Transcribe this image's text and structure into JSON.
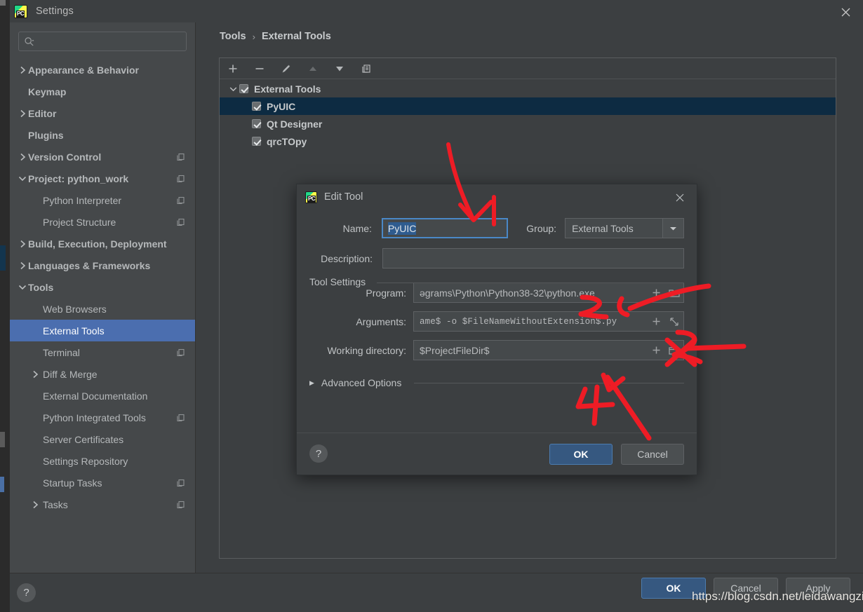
{
  "window": {
    "title": "Settings",
    "logo_icon": "pycharm-logo-icon",
    "close_icon": "close-icon"
  },
  "search": {
    "placeholder": "",
    "value": "",
    "icon": "search-icon"
  },
  "sidebar": {
    "items": [
      {
        "label": "Appearance & Behavior",
        "level": 1,
        "arrow": "chevron-right",
        "badge": false,
        "selected": false
      },
      {
        "label": "Keymap",
        "level": 1,
        "arrow": "",
        "badge": false,
        "selected": false
      },
      {
        "label": "Editor",
        "level": 1,
        "arrow": "chevron-right",
        "badge": false,
        "selected": false
      },
      {
        "label": "Plugins",
        "level": 1,
        "arrow": "",
        "badge": false,
        "selected": false
      },
      {
        "label": "Version Control",
        "level": 1,
        "arrow": "chevron-right",
        "badge": true,
        "selected": false
      },
      {
        "label": "Project: python_work",
        "level": 1,
        "arrow": "chevron-down",
        "badge": true,
        "selected": false
      },
      {
        "label": "Python Interpreter",
        "level": 2,
        "arrow": "",
        "badge": true,
        "selected": false
      },
      {
        "label": "Project Structure",
        "level": 2,
        "arrow": "",
        "badge": true,
        "selected": false
      },
      {
        "label": "Build, Execution, Deployment",
        "level": 1,
        "arrow": "chevron-right",
        "badge": false,
        "selected": false
      },
      {
        "label": "Languages & Frameworks",
        "level": 1,
        "arrow": "chevron-right",
        "badge": false,
        "selected": false
      },
      {
        "label": "Tools",
        "level": 1,
        "arrow": "chevron-down",
        "badge": false,
        "selected": false
      },
      {
        "label": "Web Browsers",
        "level": 2,
        "arrow": "",
        "badge": false,
        "selected": false
      },
      {
        "label": "External Tools",
        "level": 2,
        "arrow": "",
        "badge": false,
        "selected": true
      },
      {
        "label": "Terminal",
        "level": 2,
        "arrow": "",
        "badge": true,
        "selected": false
      },
      {
        "label": "Diff & Merge",
        "level": 2,
        "arrow": "chevron-right",
        "badge": false,
        "selected": false
      },
      {
        "label": "External Documentation",
        "level": 2,
        "arrow": "",
        "badge": false,
        "selected": false
      },
      {
        "label": "Python Integrated Tools",
        "level": 2,
        "arrow": "",
        "badge": true,
        "selected": false
      },
      {
        "label": "Server Certificates",
        "level": 2,
        "arrow": "",
        "badge": false,
        "selected": false
      },
      {
        "label": "Settings Repository",
        "level": 2,
        "arrow": "",
        "badge": false,
        "selected": false
      },
      {
        "label": "Startup Tasks",
        "level": 2,
        "arrow": "",
        "badge": true,
        "selected": false
      },
      {
        "label": "Tasks",
        "level": 2,
        "arrow": "chevron-right",
        "badge": true,
        "selected": false
      }
    ]
  },
  "main": {
    "breadcrumb": {
      "parent": "Tools",
      "separator": "›",
      "current": "External Tools"
    },
    "toolbar": [
      {
        "name": "add-button",
        "glyph": "+",
        "disabled": false
      },
      {
        "name": "remove-button",
        "glyph": "−",
        "disabled": false
      },
      {
        "name": "edit-button",
        "glyph": "pencil",
        "disabled": false
      },
      {
        "name": "move-up-button",
        "glyph": "▲",
        "disabled": true
      },
      {
        "name": "move-down-button",
        "glyph": "▼",
        "disabled": false
      },
      {
        "name": "copy-button",
        "glyph": "copy",
        "disabled": false
      }
    ],
    "tool_tree": [
      {
        "label": "External Tools",
        "level": 0,
        "checked": true,
        "expanded": true,
        "selected": false
      },
      {
        "label": "PyUIC",
        "level": 1,
        "checked": true,
        "expanded": null,
        "selected": true
      },
      {
        "label": "Qt Designer",
        "level": 1,
        "checked": true,
        "expanded": null,
        "selected": false
      },
      {
        "label": "qrcTOpy",
        "level": 1,
        "checked": true,
        "expanded": null,
        "selected": false
      }
    ]
  },
  "bottom_bar": {
    "help_icon": "help-icon",
    "ok_label": "OK",
    "cancel_label": "Cancel",
    "apply_label": "Apply"
  },
  "edit_tool_dialog": {
    "title": "Edit Tool",
    "logo_icon": "pycharm-logo-icon",
    "close_icon": "close-icon",
    "name_label": "Name:",
    "name_value": "PyUIC",
    "group_label": "Group:",
    "group_value": "External Tools",
    "group_dropdown_icon": "chevron-down-icon",
    "description_label": "Description:",
    "description_value": "",
    "tool_settings_legend": "Tool Settings",
    "program_label": "Program:",
    "program_value": "ǝgrams\\Python\\Python38-32\\python.exe",
    "arguments_label": "Arguments:",
    "arguments_value": "ame$ -o $FileNameWithoutExtension$.py",
    "working_directory_label": "Working directory:",
    "working_directory_value": "$ProjectFileDir$",
    "insert_macro_icon": "plus-icon",
    "browse_icon": "folder-icon",
    "expand_icon": "expand-icon",
    "advanced_options_label": "Advanced Options",
    "advanced_options_icon": "triangle-right-icon",
    "help_icon": "help-icon",
    "ok_label": "OK",
    "cancel_label": "Cancel"
  },
  "annotations": {
    "color": "#ee1c25",
    "marks": [
      {
        "id": "1",
        "label": "1",
        "target": "name-field"
      },
      {
        "id": "2",
        "label": "2",
        "target": "program-field"
      },
      {
        "id": "3",
        "label": "3",
        "target": "arguments-field"
      },
      {
        "id": "4",
        "label": "4",
        "target": "working-directory-field"
      }
    ]
  },
  "watermark": {
    "text": "https://blog.csdn.net/leidawangzi"
  },
  "colors": {
    "window_bg": "#3c3f41",
    "sidebar_bg": "#45484a",
    "sidebar_selected": "#4b6eaf",
    "tree_selected": "#0d2b42",
    "accent_button": "#365880",
    "field_bg": "#45494b",
    "focus_border": "#4a88c7",
    "text": "#bbbbbb",
    "annotation_red": "#ee1c25"
  }
}
